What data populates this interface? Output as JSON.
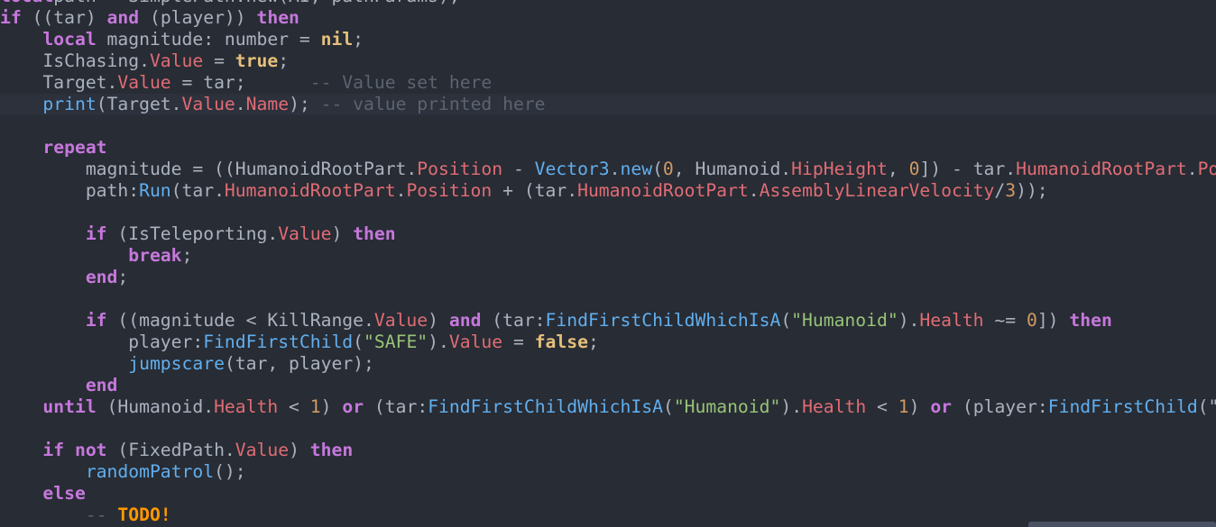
{
  "editor": {
    "current_line": 5,
    "lines": [
      [
        [
          "kw",
          "local"
        ],
        [
          "",
          "path = SimplePath.new(AI, pathParams);"
        ]
      ],
      [
        [
          "kw",
          "if"
        ],
        [
          "",
          " ((tar) "
        ],
        [
          "kw",
          "and"
        ],
        [
          "",
          " (player)) "
        ],
        [
          "kw",
          "then"
        ]
      ],
      [
        [
          "",
          "    "
        ],
        [
          "kw",
          "local"
        ],
        [
          "",
          " magnitude: number = "
        ],
        [
          "bool",
          "nil"
        ],
        [
          "",
          ";"
        ]
      ],
      [
        [
          "",
          "    IsChasing."
        ],
        [
          "prop",
          "Value"
        ],
        [
          "",
          " = "
        ],
        [
          "bool",
          "true"
        ],
        [
          "",
          ";"
        ]
      ],
      [
        [
          "",
          "    Target."
        ],
        [
          "prop",
          "Value"
        ],
        [
          "",
          " = tar;      "
        ],
        [
          "cmt",
          "-- Value set here"
        ]
      ],
      [
        [
          "",
          "    "
        ],
        [
          "fn",
          "print"
        ],
        [
          "",
          "(Target."
        ],
        [
          "prop",
          "Value"
        ],
        [
          "",
          "."
        ],
        [
          "prop",
          "Name"
        ],
        [
          "",
          "); "
        ],
        [
          "cmt",
          "-- value printed here"
        ]
      ],
      [],
      [
        [
          "",
          "    "
        ],
        [
          "kw",
          "repeat"
        ]
      ],
      [
        [
          "",
          "        magnitude = ((HumanoidRootPart."
        ],
        [
          "prop",
          "Position"
        ],
        [
          "",
          " - "
        ],
        [
          "fn",
          "Vector3"
        ],
        [
          "",
          "."
        ],
        [
          "fn",
          "new"
        ],
        [
          "",
          "("
        ],
        [
          "num",
          "0"
        ],
        [
          "",
          ", Humanoid."
        ],
        [
          "prop",
          "HipHeight"
        ],
        [
          "",
          ", "
        ],
        [
          "num",
          "0"
        ],
        [
          "",
          "]) - tar."
        ],
        [
          "prop",
          "HumanoidRootPart"
        ],
        [
          "",
          "."
        ],
        [
          "prop",
          "Position"
        ]
      ],
      [
        [
          "",
          "        path:"
        ],
        [
          "fn",
          "Run"
        ],
        [
          "",
          "(tar."
        ],
        [
          "prop",
          "HumanoidRootPart"
        ],
        [
          "",
          "."
        ],
        [
          "prop",
          "Position"
        ],
        [
          "",
          " + (tar."
        ],
        [
          "prop",
          "HumanoidRootPart"
        ],
        [
          "",
          "."
        ],
        [
          "prop",
          "AssemblyLinearVelocity"
        ],
        [
          "",
          "/"
        ],
        [
          "num",
          "3"
        ],
        [
          "",
          "));"
        ]
      ],
      [],
      [
        [
          "",
          "        "
        ],
        [
          "kw",
          "if"
        ],
        [
          "",
          " (IsTeleporting."
        ],
        [
          "prop",
          "Value"
        ],
        [
          "",
          ") "
        ],
        [
          "kw",
          "then"
        ]
      ],
      [
        [
          "",
          "            "
        ],
        [
          "kw",
          "break"
        ],
        [
          "",
          ";"
        ]
      ],
      [
        [
          "",
          "        "
        ],
        [
          "kw",
          "end"
        ],
        [
          "",
          ";"
        ]
      ],
      [],
      [
        [
          "",
          "        "
        ],
        [
          "kw",
          "if"
        ],
        [
          "",
          " ((magnitude < KillRange."
        ],
        [
          "prop",
          "Value"
        ],
        [
          "",
          ") "
        ],
        [
          "kw",
          "and"
        ],
        [
          "",
          " (tar:"
        ],
        [
          "fn",
          "FindFirstChildWhichIsA"
        ],
        [
          "",
          "("
        ],
        [
          "str",
          "\"Humanoid\""
        ],
        [
          "",
          ")."
        ],
        [
          "prop",
          "Health"
        ],
        [
          "",
          " ~= "
        ],
        [
          "num",
          "0"
        ],
        [
          "",
          "]) "
        ],
        [
          "kw",
          "then"
        ]
      ],
      [
        [
          "",
          "            player:"
        ],
        [
          "fn",
          "FindFirstChild"
        ],
        [
          "",
          "("
        ],
        [
          "str",
          "\"SAFE\""
        ],
        [
          "",
          ")."
        ],
        [
          "prop",
          "Value"
        ],
        [
          "",
          " = "
        ],
        [
          "bool",
          "false"
        ],
        [
          "",
          ";"
        ]
      ],
      [
        [
          "",
          "            "
        ],
        [
          "fn",
          "jumpscare"
        ],
        [
          "",
          "(tar, player);"
        ]
      ],
      [
        [
          "",
          "        "
        ],
        [
          "kw",
          "end"
        ]
      ],
      [
        [
          "",
          "    "
        ],
        [
          "kw",
          "until"
        ],
        [
          "",
          " (Humanoid."
        ],
        [
          "prop",
          "Health"
        ],
        [
          "",
          " < "
        ],
        [
          "num",
          "1"
        ],
        [
          "",
          ") "
        ],
        [
          "kw",
          "or"
        ],
        [
          "",
          " (tar:"
        ],
        [
          "fn",
          "FindFirstChildWhichIsA"
        ],
        [
          "",
          "("
        ],
        [
          "str",
          "\"Humanoid\""
        ],
        [
          "",
          ")."
        ],
        [
          "prop",
          "Health"
        ],
        [
          "",
          " < "
        ],
        [
          "num",
          "1"
        ],
        [
          "",
          ") "
        ],
        [
          "kw",
          "or"
        ],
        [
          "",
          " (player:"
        ],
        [
          "fn",
          "FindFirstChild"
        ],
        [
          "",
          "(\"S"
        ]
      ],
      [],
      [
        [
          "",
          "    "
        ],
        [
          "kw",
          "if not"
        ],
        [
          "",
          " (FixedPath."
        ],
        [
          "prop",
          "Value"
        ],
        [
          "",
          ") "
        ],
        [
          "kw",
          "then"
        ]
      ],
      [
        [
          "",
          "        "
        ],
        [
          "fn",
          "randomPatrol"
        ],
        [
          "",
          "();"
        ]
      ],
      [
        [
          "",
          "    "
        ],
        [
          "kw",
          "else"
        ]
      ],
      [
        [
          "",
          "        "
        ],
        [
          "cmt",
          "-- "
        ],
        [
          "todo",
          "TODO!"
        ]
      ]
    ]
  }
}
